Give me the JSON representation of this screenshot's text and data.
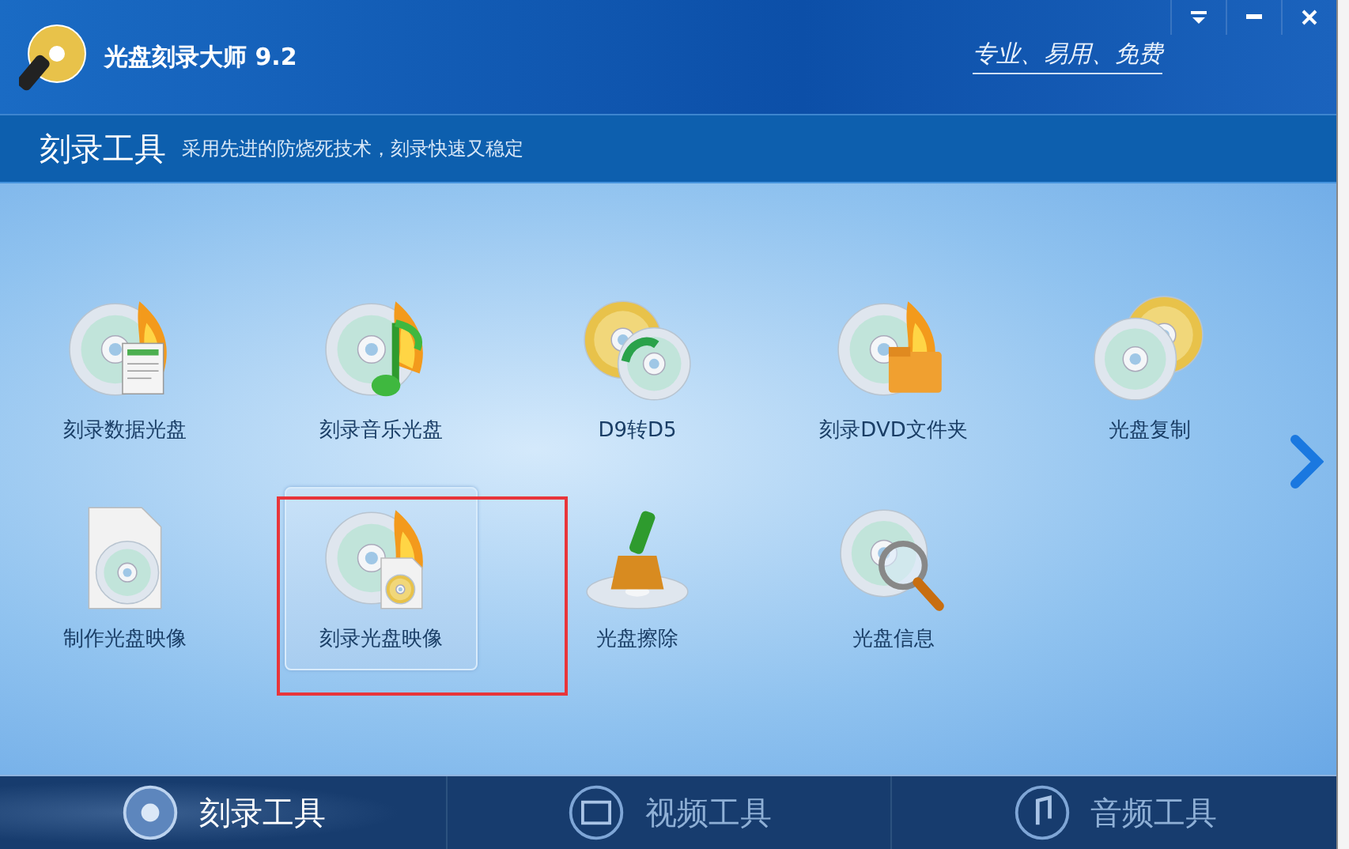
{
  "window": {
    "title": "光盘刻录大师 9.2",
    "slogan": "专业、易用、免费"
  },
  "section": {
    "title": "刻录工具",
    "description": "采用先进的防烧死技术，刻录快速又稳定"
  },
  "tools": [
    {
      "label": "刻录数据光盘",
      "kind": "data",
      "selected": false
    },
    {
      "label": "刻录音乐光盘",
      "kind": "music",
      "selected": false
    },
    {
      "label": "D9转D5",
      "kind": "convert",
      "selected": false
    },
    {
      "label": "刻录DVD文件夹",
      "kind": "folder",
      "selected": false
    },
    {
      "label": "光盘复制",
      "kind": "copy",
      "selected": false
    },
    {
      "label": "制作光盘映像",
      "kind": "makeimage",
      "selected": false
    },
    {
      "label": "刻录光盘映像",
      "kind": "burnimage",
      "selected": true
    },
    {
      "label": "光盘擦除",
      "kind": "erase",
      "selected": false
    },
    {
      "label": "光盘信息",
      "kind": "info",
      "selected": false
    }
  ],
  "bottom_tabs": [
    {
      "label": "刻录工具",
      "kind": "disc",
      "selected": true
    },
    {
      "label": "视频工具",
      "kind": "video",
      "selected": false
    },
    {
      "label": "音频工具",
      "kind": "audio",
      "selected": false
    }
  ]
}
